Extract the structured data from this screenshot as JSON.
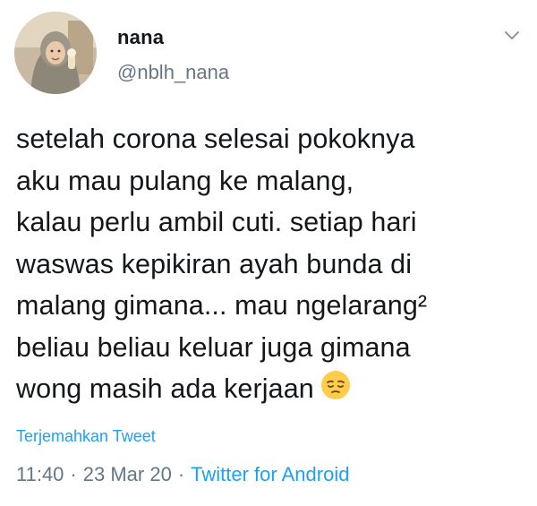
{
  "tweet": {
    "display_name": "nana",
    "handle": "@nblh_nana",
    "text_lines": [
      "setelah corona selesai pokoknya",
      "aku mau pulang ke malang,",
      "kalau perlu ambil cuti. setiap hari",
      "waswas kepikiran ayah bunda di",
      "malang gimana... mau ngelarang²",
      "beliau beliau keluar juga gimana",
      "wong masih ada kerjaan"
    ],
    "emoji": "pensive-face",
    "translate_label": "Terjemahkan Tweet",
    "time": "11:40",
    "separator": "·",
    "date": "23 Mar 20",
    "source": "Twitter for Android"
  },
  "colors": {
    "text": "#14171a",
    "secondary": "#657786",
    "link": "#1da1f2"
  },
  "icons": {
    "menu": "chevron-down-icon",
    "avatar": "profile-photo"
  }
}
